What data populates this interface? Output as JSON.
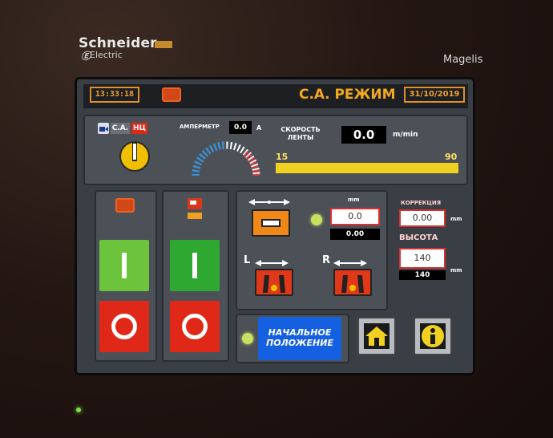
{
  "bezel": {
    "brand": "Schneider",
    "brand_sub": "Electric",
    "model": "Magelis"
  },
  "header": {
    "time": "13:33:18",
    "mode_title": "С.А. РЕЖИМ",
    "date": "31/10/2019"
  },
  "mode_selector": {
    "option_sa": "С.А.",
    "option_nc": "НЦ"
  },
  "ammeter": {
    "label": "АМПЕРМЕТР",
    "value": "0.0",
    "unit": "A"
  },
  "belt_speed": {
    "label_line1": "СКОРОСТЬ",
    "label_line2": "ЛЕНТЫ",
    "value": "0.0",
    "unit": "m/min",
    "min": "15",
    "max": "90",
    "level_percent": 100
  },
  "controls": {
    "width": {
      "unit_label": "mm",
      "setpoint": "0.0",
      "actual": "0.00"
    },
    "left_label": "L",
    "right_label": "R"
  },
  "correction": {
    "label": "КОРРЕКЦИЯ",
    "value": "0.00",
    "unit": "mm"
  },
  "height": {
    "label": "ВЫСОТА",
    "setpoint": "140",
    "actual": "140",
    "unit": "mm"
  },
  "home_position": {
    "line1": "НАЧАЛЬНОЕ",
    "line2": "ПОЛОЖЕНИЕ"
  },
  "colors": {
    "accent": "#f4a820",
    "start_green": "#6cc43c",
    "stop_red": "#e02818",
    "info_blue": "#1560e0"
  }
}
